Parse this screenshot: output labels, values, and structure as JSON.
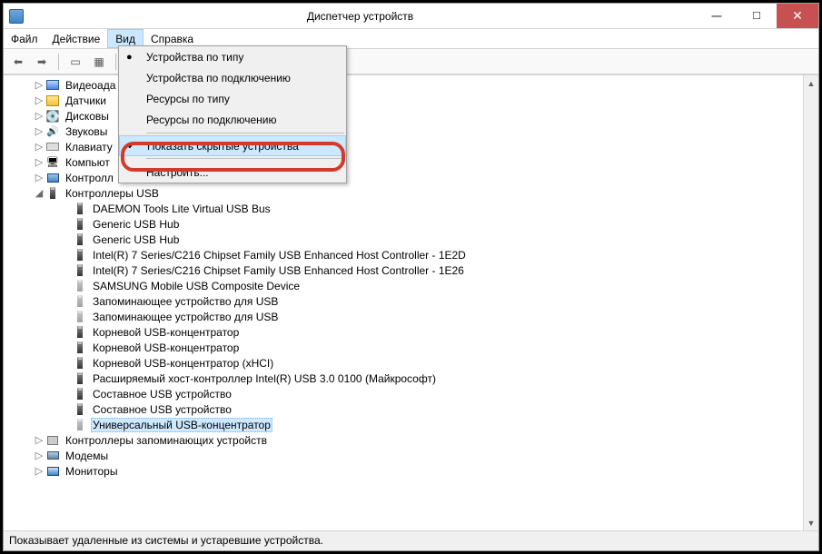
{
  "title": "Диспетчер устройств",
  "menu": {
    "file": "Файл",
    "action": "Действие",
    "view": "Вид",
    "help": "Справка"
  },
  "dropdown": {
    "byType": "Устройства по типу",
    "byConn": "Устройства по подключению",
    "resType": "Ресурсы по типу",
    "resConn": "Ресурсы по подключению",
    "showHidden": "Показать скрытые устройства",
    "customize": "Настроить..."
  },
  "cats": {
    "video": "Видеоада",
    "sensors": "Датчики",
    "disks": "Дисковы",
    "sound": "Звуковы",
    "keyboard": "Клавиату",
    "computer": "Компьют",
    "controllers": "Контролл",
    "usbCtrls": "Контроллеры USB",
    "storageCtrls": "Контроллеры запоминающих устройств",
    "modems": "Модемы",
    "monitors": "Мониторы"
  },
  "usb": [
    "DAEMON Tools Lite Virtual USB Bus",
    "Generic USB Hub",
    "Generic USB Hub",
    "Intel(R) 7 Series/C216 Chipset Family USB Enhanced Host Controller - 1E2D",
    "Intel(R) 7 Series/C216 Chipset Family USB Enhanced Host Controller - 1E26",
    "SAMSUNG Mobile USB Composite Device",
    "Запоминающее устройство для USB",
    "Запоминающее устройство для USB",
    "Корневой USB-концентратор",
    "Корневой USB-концентратор",
    "Корневой USB-концентратор (xHCI)",
    "Расширяемый хост-контроллер Intel(R) USB 3.0 0100 (Майкрософт)",
    "Составное USB устройство",
    "Составное USB устройство",
    "Универсальный USB-концентратор"
  ],
  "usbFaded": [
    false,
    false,
    false,
    false,
    false,
    true,
    true,
    true,
    false,
    false,
    false,
    false,
    false,
    false,
    true
  ],
  "status": "Показывает удаленные из системы и устаревшие устройства."
}
